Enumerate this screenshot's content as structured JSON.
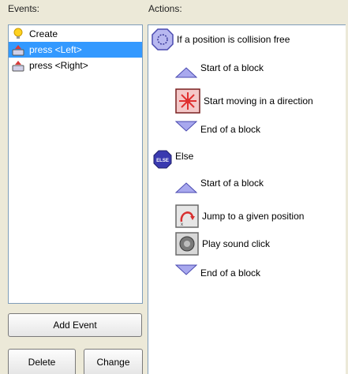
{
  "events_label": "Events:",
  "actions_label": "Actions:",
  "events": [
    {
      "label": "Create",
      "icon": "lightbulb-icon",
      "selected": false
    },
    {
      "label": "press <Left>",
      "icon": "keyboard-key-icon",
      "selected": true
    },
    {
      "label": "press <Right>",
      "icon": "keyboard-key-icon",
      "selected": false
    }
  ],
  "actions": [
    {
      "label": "If a position is collision free",
      "icon": "collision-free-icon"
    },
    {
      "label": "Start of a block",
      "icon": "start-block-icon"
    },
    {
      "label": "Start moving in a direction",
      "icon": "move-direction-icon"
    },
    {
      "label": "End of a block",
      "icon": "end-block-icon"
    },
    {
      "label": "Else",
      "icon": "else-icon",
      "icon_text": "ELSE"
    },
    {
      "label": "Start of a block",
      "icon": "start-block-icon"
    },
    {
      "label": "Jump to a given position",
      "icon": "jump-position-icon"
    },
    {
      "label": "Play sound click",
      "icon": "play-sound-icon"
    },
    {
      "label": "End of a block",
      "icon": "end-block-icon"
    }
  ],
  "buttons": {
    "add_event": "Add Event",
    "delete": "Delete",
    "change": "Change"
  },
  "colors": {
    "selection": "#3399ff",
    "list_border": "#7f9db9",
    "window_bg": "#ece9d8"
  }
}
